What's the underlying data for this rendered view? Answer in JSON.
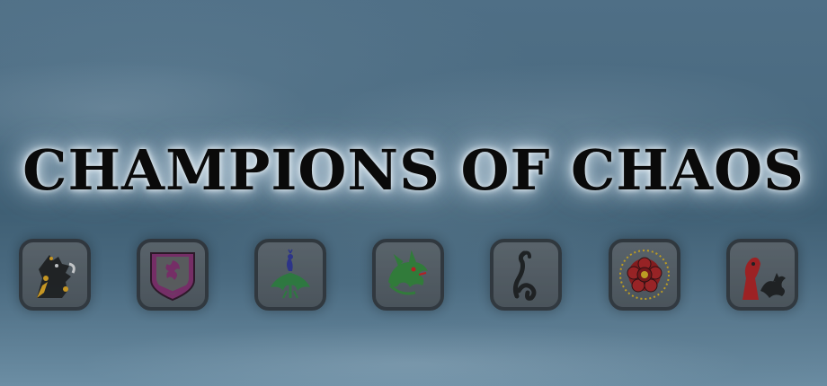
{
  "title": "CHAMPIONS OF CHAOS",
  "icons": [
    {
      "name": "wolf-icon",
      "accent": "#d39b1a"
    },
    {
      "name": "phoenix-shield-icon",
      "accent": "#7a2864"
    },
    {
      "name": "peacock-icon",
      "accent": "#2b7a3a"
    },
    {
      "name": "dragon-icon",
      "accent": "#2f7d33"
    },
    {
      "name": "serpent-icon",
      "accent": "#1e1e1e"
    },
    {
      "name": "rose-icon",
      "accent": "#8a1414"
    },
    {
      "name": "red-dragon-icon",
      "accent": "#a51a1a"
    }
  ]
}
